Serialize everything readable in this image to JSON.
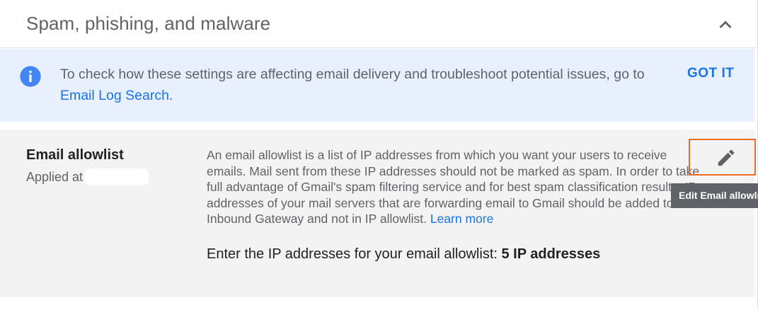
{
  "section": {
    "title": "Spam, phishing, and malware",
    "collapse_icon": "chevron-up-icon"
  },
  "banner": {
    "text": "To check how these settings are affecting email delivery and troubleshoot potential issues, go to ",
    "link": "Email Log Search",
    "link_suffix": ".",
    "dismiss_label": "GOT IT",
    "icon": "info-icon",
    "background": "#e8f0fe",
    "accent": "#1a73e8"
  },
  "setting": {
    "name": "Email allowlist",
    "applied_prefix": "Applied at",
    "description": "An email allowlist is a list of IP addresses from which you want your users to receive emails. Mail sent from these IP addresses should not be marked as spam. In order to take full advantage of Gmail's spam filtering service and for best spam classification results, IP addresses of your mail servers that are forwarding email to Gmail should be added to Inbound Gateway and not in IP allowlist. ",
    "learn_more": "Learn more",
    "summary_label": "Enter the IP addresses for your email allowlist: ",
    "summary_value": "5 IP addresses",
    "edit_icon": "pencil-icon",
    "highlight_color": "#ee6b22"
  },
  "tooltip": {
    "text": "Edit Email allowlist"
  }
}
